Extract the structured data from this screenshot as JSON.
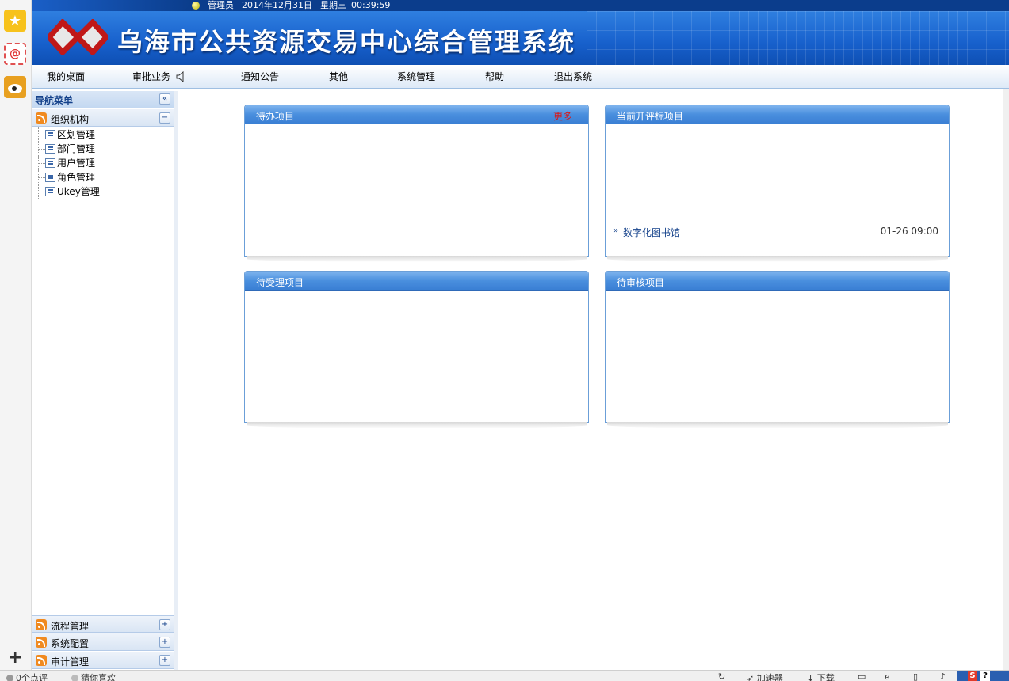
{
  "header": {
    "user": "管理员",
    "date": "2014年12月31日",
    "weekday": "星期三",
    "time": "00:39:59",
    "system_title": "乌海市公共资源交易中心综合管理系统"
  },
  "menu": [
    {
      "label": "我的桌面"
    },
    {
      "label": "审批业务"
    },
    {
      "label": "通知公告"
    },
    {
      "label": "其他"
    },
    {
      "label": "系统管理"
    },
    {
      "label": "帮助"
    },
    {
      "label": "退出系统"
    }
  ],
  "nav": {
    "title": "导航菜单",
    "collapse_icon": "«",
    "sections": [
      {
        "label": "组织机构",
        "toggle": "−"
      },
      {
        "label": "流程管理",
        "toggle": "+"
      },
      {
        "label": "系统配置",
        "toggle": "+"
      },
      {
        "label": "审计管理",
        "toggle": "+"
      }
    ],
    "tree_items": [
      {
        "label": "区划管理"
      },
      {
        "label": "部门管理"
      },
      {
        "label": "用户管理"
      },
      {
        "label": "角色管理"
      },
      {
        "label": "Ukey管理"
      }
    ]
  },
  "panels": {
    "todo": {
      "title": "待办项目",
      "more": "更多"
    },
    "bidding": {
      "title": "当前开评标项目",
      "items": [
        {
          "name": "数字化图书馆",
          "time": "01-26 09:00",
          "arrow": "»"
        }
      ]
    },
    "pending_accept": {
      "title": "待受理项目"
    },
    "pending_review": {
      "title": "待审核项目"
    }
  },
  "statusbar": {
    "comments": "0个点评",
    "guess": "猜你喜欢",
    "accelerator": "加速器",
    "download": "下载"
  }
}
